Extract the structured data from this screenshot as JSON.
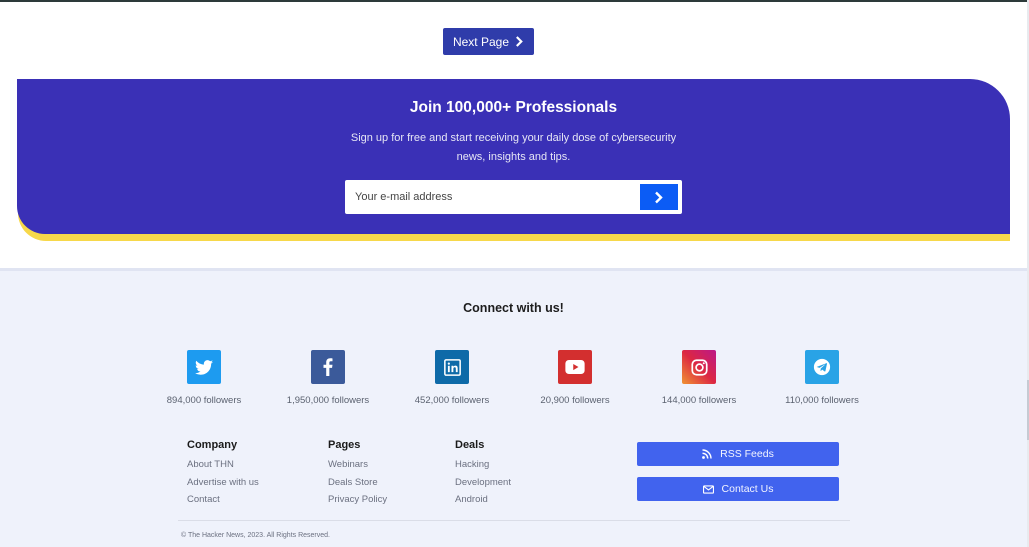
{
  "pagination": {
    "next_label": "Next Page"
  },
  "newsletter": {
    "title": "Join 100,000+ Professionals",
    "description": "Sign up for free and start receiving your daily dose of cybersecurity news, insights and tips.",
    "email_placeholder": "Your e-mail address"
  },
  "footer": {
    "connect_title": "Connect with us!",
    "social": [
      {
        "network": "twitter",
        "icon": "twitter-icon",
        "color": "#1d9bf0",
        "followers": "894,000 followers"
      },
      {
        "network": "facebook",
        "icon": "facebook-icon",
        "color": "#3b5a9a",
        "followers": "1,950,000 followers"
      },
      {
        "network": "linkedin",
        "icon": "linkedin-icon",
        "color": "#0e6aa8",
        "followers": "452,000 followers"
      },
      {
        "network": "youtube",
        "icon": "youtube-icon",
        "color": "#d32f2f",
        "followers": "20,900 followers"
      },
      {
        "network": "instagram",
        "icon": "instagram-icon",
        "color": "#d6249f",
        "followers": "144,000 followers"
      },
      {
        "network": "telegram",
        "icon": "telegram-icon",
        "color": "#29a3e6",
        "followers": "110,000 followers"
      }
    ],
    "columns": [
      {
        "heading": "Company",
        "links": [
          "About THN",
          "Advertise with us",
          "Contact"
        ]
      },
      {
        "heading": "Pages",
        "links": [
          "Webinars",
          "Deals Store",
          "Privacy Policy"
        ]
      },
      {
        "heading": "Deals",
        "links": [
          "Hacking",
          "Development",
          "Android"
        ]
      }
    ],
    "buttons": {
      "rss": "RSS Feeds",
      "contact": "Contact Us"
    },
    "copyright": "© The Hacker News, 2023. All Rights Reserved."
  },
  "colors": {
    "accent": "#3a30b6",
    "highlight": "#f7d84a",
    "button": "#4163ee",
    "submit": "#0b5cf5"
  }
}
